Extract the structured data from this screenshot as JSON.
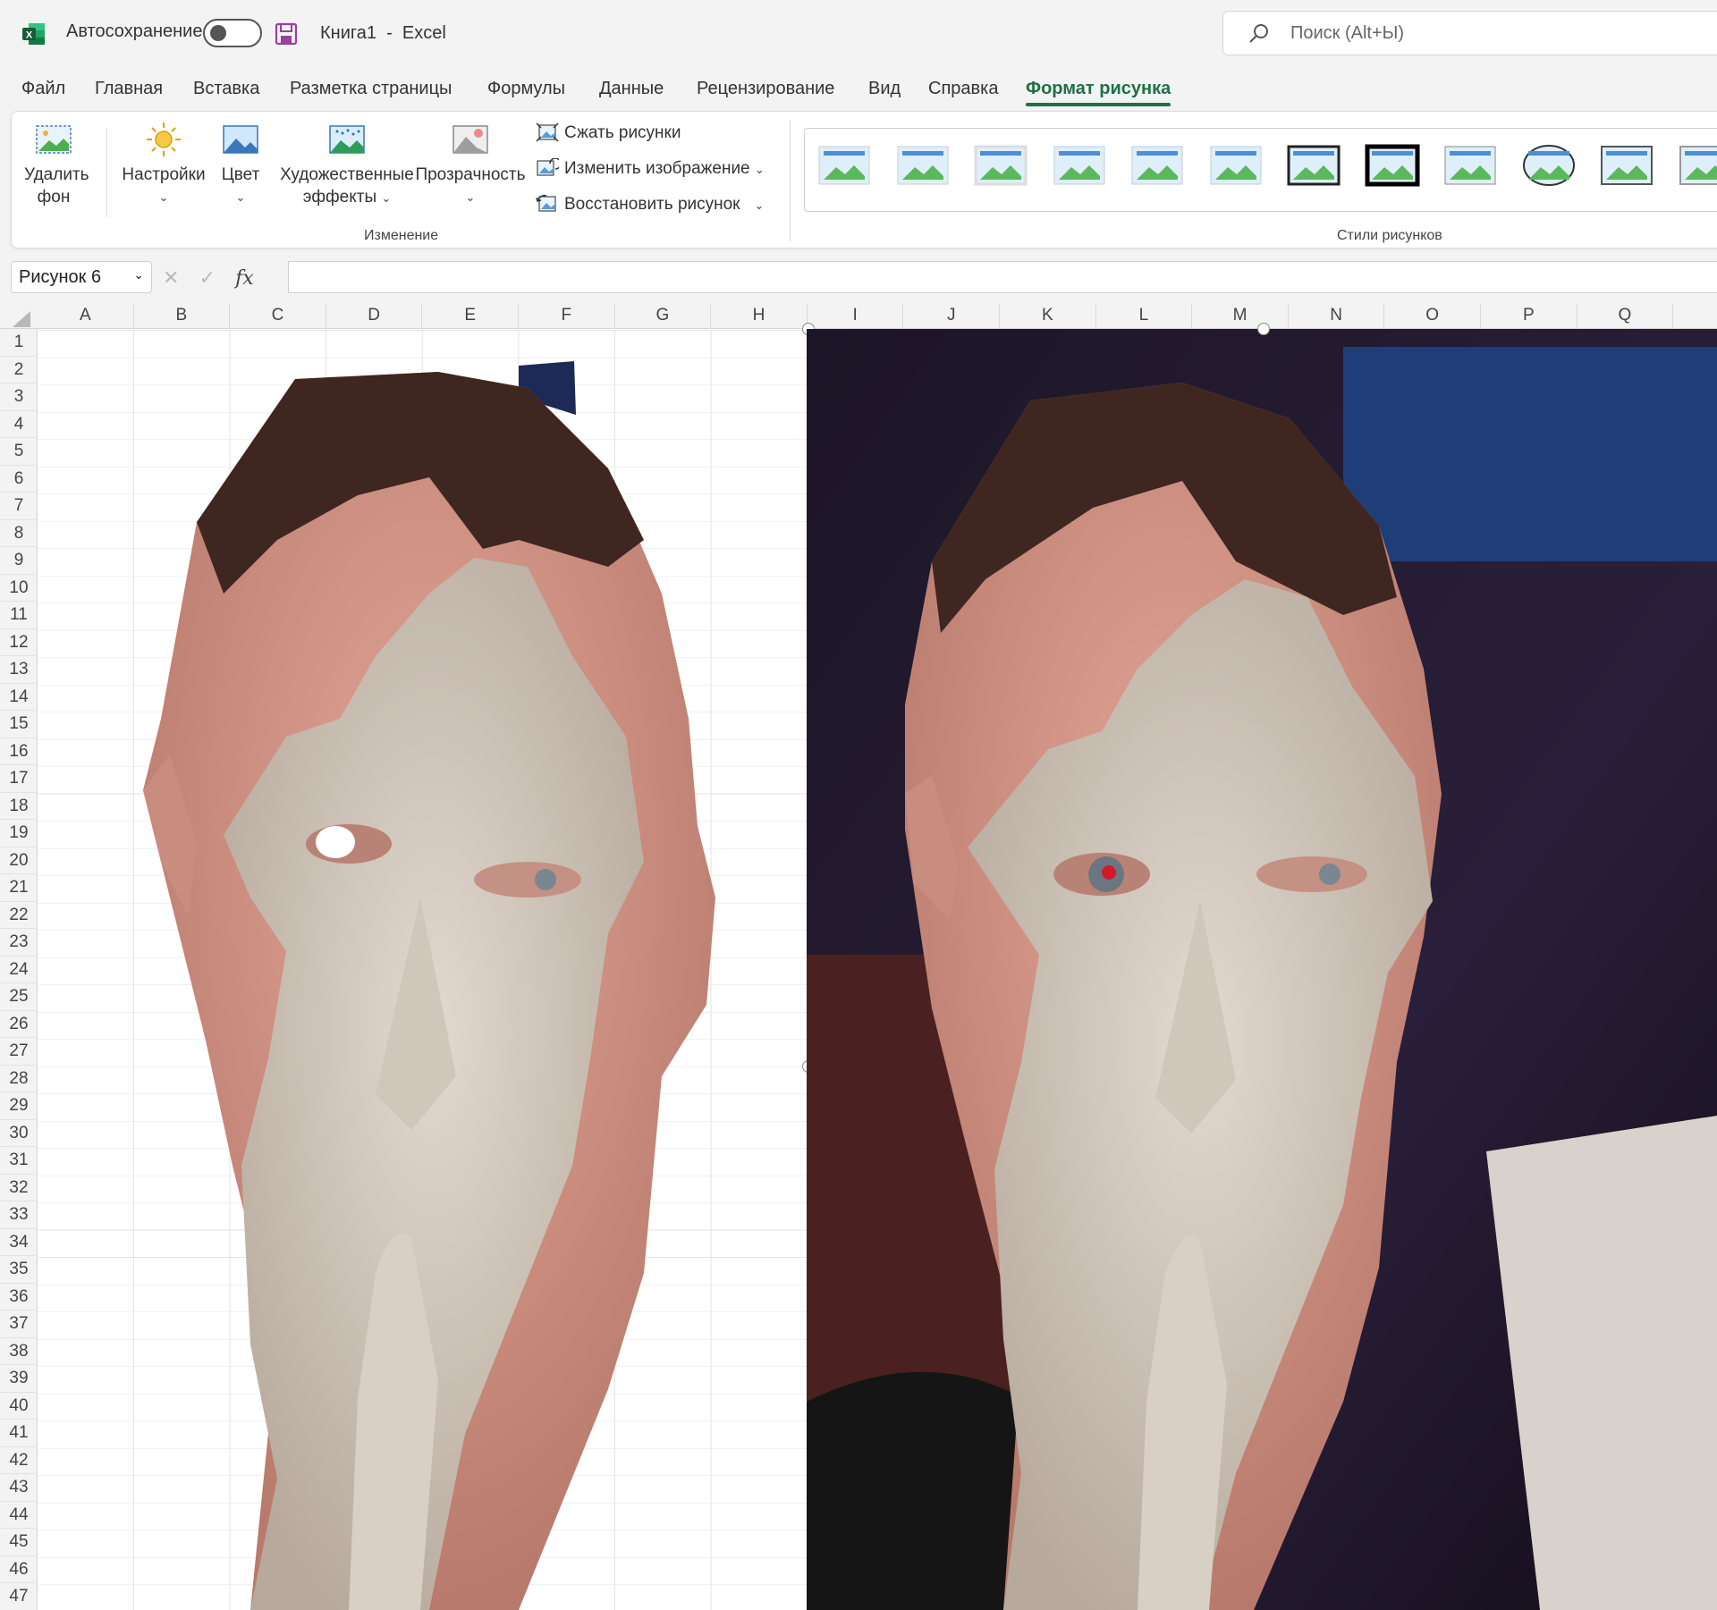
{
  "titlebar": {
    "autosave_label": "Автосохранение",
    "doc_name": "Книга1",
    "separator": "-",
    "app_name": "Excel",
    "search_placeholder": "Поиск (Alt+Ы)"
  },
  "tabs": [
    {
      "label": "Файл"
    },
    {
      "label": "Главная"
    },
    {
      "label": "Вставка"
    },
    {
      "label": "Разметка страницы"
    },
    {
      "label": "Формулы"
    },
    {
      "label": "Данные"
    },
    {
      "label": "Рецензирование"
    },
    {
      "label": "Вид"
    },
    {
      "label": "Справка"
    },
    {
      "label": "Формат рисунка",
      "active": true
    }
  ],
  "ribbon": {
    "remove_bg": {
      "line1": "Удалить",
      "line2": "фон"
    },
    "corrections": "Настройки",
    "color": "Цвет",
    "artistic": {
      "line1": "Художественные",
      "line2": "эффекты"
    },
    "transparency": "Прозрачность",
    "compress": "Сжать рисунки",
    "change_picture": "Изменить изображение",
    "reset_picture": "Восстановить рисунок",
    "group_adjust": "Изменение",
    "group_styles": "Стили рисунков",
    "chevron": "⌄"
  },
  "formula_bar": {
    "name_box": "Рисунок 6",
    "cancel": "✕",
    "enter": "✓",
    "fx": "fx"
  },
  "columns": [
    "A",
    "B",
    "C",
    "D",
    "E",
    "F",
    "G",
    "H",
    "I",
    "J",
    "K",
    "L",
    "M",
    "N",
    "O",
    "P",
    "Q"
  ],
  "rows": [
    "1",
    "2",
    "3",
    "4",
    "5",
    "6",
    "7",
    "8",
    "9",
    "10",
    "11",
    "12",
    "13",
    "14",
    "15",
    "16",
    "17",
    "18",
    "19",
    "20",
    "21",
    "22",
    "23",
    "24",
    "25",
    "26",
    "27",
    "28",
    "29",
    "30",
    "31",
    "32",
    "33",
    "34",
    "35",
    "36",
    "37",
    "38",
    "39",
    "40",
    "41",
    "42",
    "43",
    "44",
    "45",
    "46",
    "47"
  ],
  "colors": {
    "excel_green": "#1e7145",
    "accent_tab": "#1e7145"
  }
}
